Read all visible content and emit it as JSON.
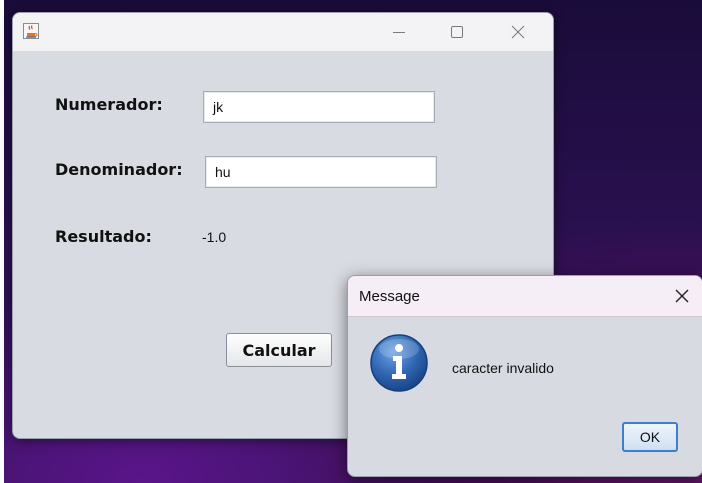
{
  "main_window": {
    "title": "",
    "labels": {
      "numerador": "Numerador:",
      "denominador": "Denominador:",
      "resultado": "Resultado:"
    },
    "fields": {
      "numerador_value": "jk",
      "denominador_value": "hu"
    },
    "resultado_value": "-1.0",
    "calcular_label": "Calcular",
    "icons": {
      "app": "java-app-icon",
      "minimize": "minimize-icon",
      "maximize": "maximize-icon",
      "close": "close-icon"
    }
  },
  "dialog": {
    "title": "Message",
    "message": "caracter invalido",
    "ok_label": "OK",
    "icons": {
      "info": "info-icon",
      "close": "close-icon"
    },
    "colors": {
      "info_blue": "#2f66b3",
      "ok_border": "#3c7fd0"
    }
  }
}
